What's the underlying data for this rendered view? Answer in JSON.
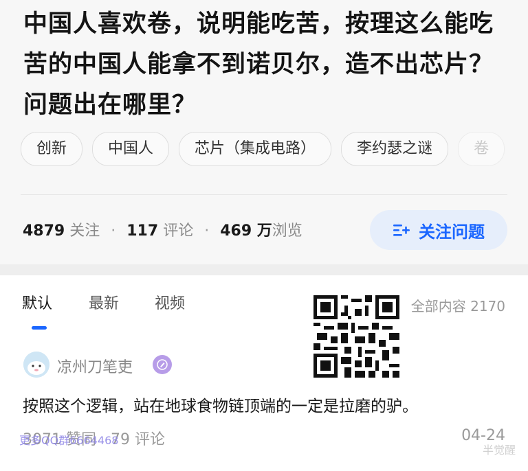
{
  "question": {
    "title": "中国人喜欢卷，说明能吃苦，按理这么能吃苦的中国人能拿不到诺贝尔，造不出芯片？问题出在哪里？"
  },
  "topics": [
    "创新",
    "中国人",
    "芯片（集成电路）",
    "李约瑟之谜",
    "卷"
  ],
  "stats": {
    "followers": "4879",
    "followers_label": "关注",
    "comments": "117",
    "comments_label": "评论",
    "views": "469 万",
    "views_label": "浏览",
    "separator": "·"
  },
  "follow_button": {
    "label": "关注问题",
    "icon": "follow-list-icon"
  },
  "tabs": [
    {
      "label": "默认",
      "active": true
    },
    {
      "label": "最新",
      "active": false
    },
    {
      "label": "视频",
      "active": false
    }
  ],
  "all_content": "全部内容 2170",
  "answer": {
    "author": "凉州刀笔吏",
    "text": "按照这个逻辑，站在地球食物链顶端的一定是拉磨的驴。",
    "likes": "3071",
    "likes_label": "赞同",
    "comments": "79",
    "comments_label": "评论",
    "date": "04-24"
  },
  "watermarks": {
    "left": "更多QQ群6664468",
    "corner": "半觉醒"
  },
  "colors": {
    "accent": "#1a66ff",
    "button_bg": "#e6eefb"
  }
}
